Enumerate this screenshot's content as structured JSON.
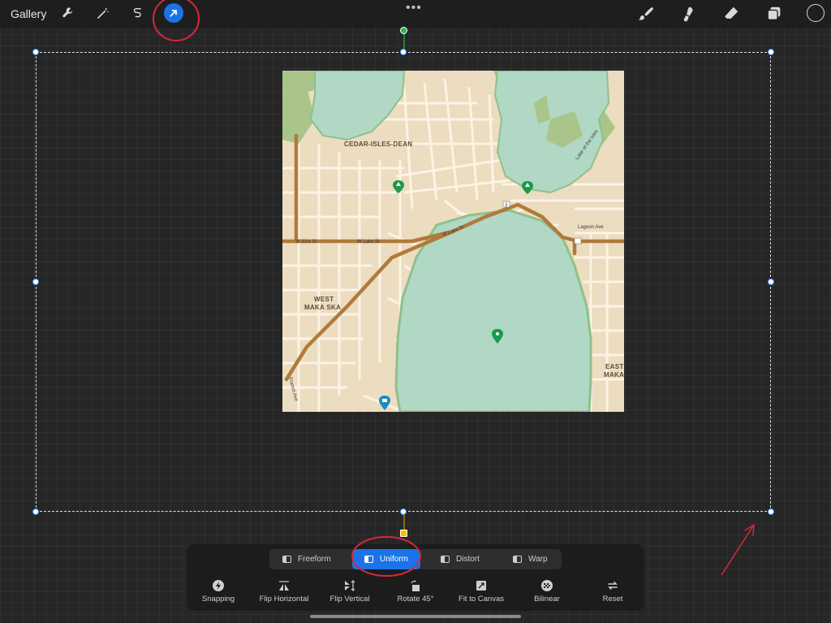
{
  "toolbar": {
    "gallery_label": "Gallery",
    "left_tools": [
      "wrench-icon",
      "magic-wand-icon",
      "selection-s-icon",
      "transform-arrow-icon"
    ],
    "active_tool": "transform-arrow-icon",
    "more_label": "•••",
    "right_tools": [
      "brush-icon",
      "smudge-icon",
      "eraser-icon",
      "layers-icon",
      "color-circle-icon"
    ],
    "accent_color": "#1a73e8"
  },
  "map": {
    "labels": {
      "cedar_isles": "CEDAR-ISLES-DEAN",
      "west_maka_ska_1": "WEST",
      "west_maka_ska_2": "MAKA SKA",
      "east_maka_1": "EAST",
      "east_maka_2": "MAKA",
      "w31st": "W 31st St",
      "wlake1": "W Lake St",
      "wlake2": "W Lake St",
      "lagoon": "Lagoon Ave",
      "lake_of_isles": "Lake of the Isles",
      "france": "France Ave",
      "route_3": "3"
    },
    "colors": {
      "land": "#ecdcc0",
      "water": "#b0d8c4",
      "park": "#a9c58a",
      "road_major": "#b07a3a",
      "road_minor": "#fbf3e4"
    }
  },
  "transform": {
    "modes": [
      {
        "label": "Freeform",
        "active": false
      },
      {
        "label": "Uniform",
        "active": true
      },
      {
        "label": "Distort",
        "active": false
      },
      {
        "label": "Warp",
        "active": false
      }
    ],
    "actions": [
      {
        "label": "Snapping",
        "icon": "lightning-icon"
      },
      {
        "label": "Flip Horizontal",
        "icon": "flip-horizontal-icon"
      },
      {
        "label": "Flip Vertical",
        "icon": "flip-vertical-icon"
      },
      {
        "label": "Rotate 45°",
        "icon": "rotate-icon"
      },
      {
        "label": "Fit to Canvas",
        "icon": "fit-canvas-icon"
      },
      {
        "label": "Bilinear",
        "icon": "bilinear-icon"
      },
      {
        "label": "Reset",
        "icon": "reset-icon"
      }
    ]
  },
  "annotation_color": "#d8283a"
}
